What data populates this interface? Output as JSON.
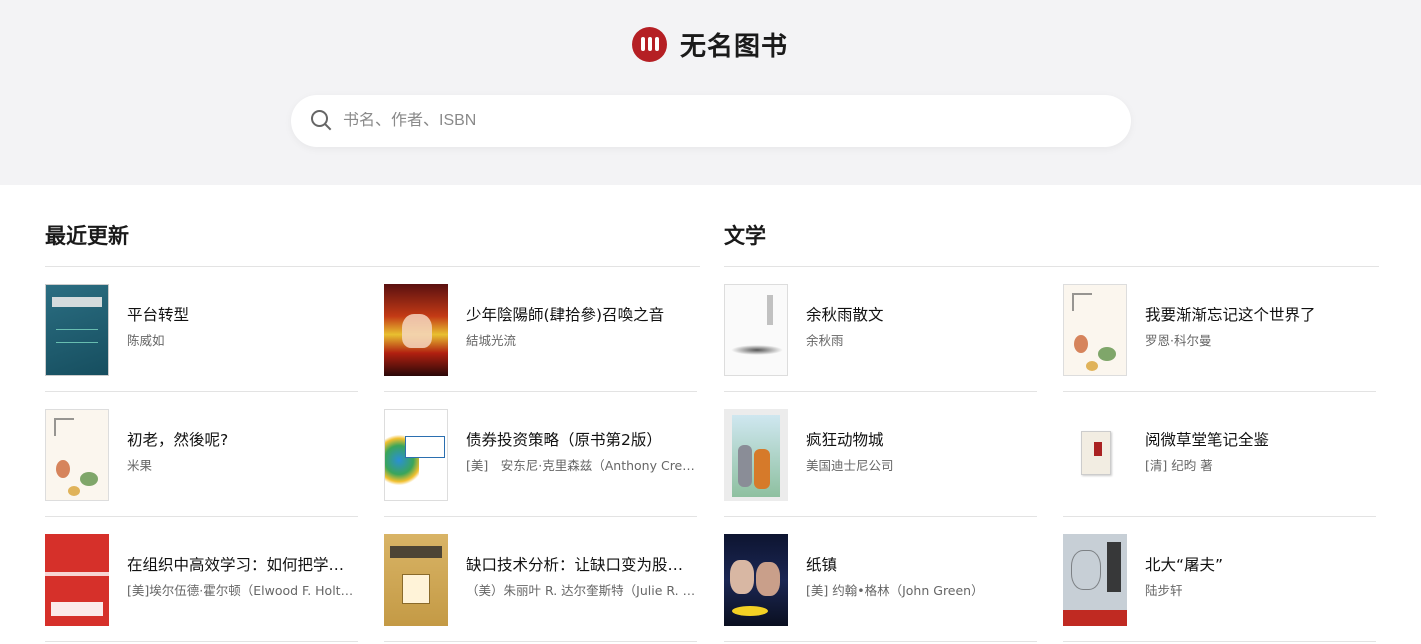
{
  "brand": {
    "name": "无名图书",
    "accent": "#b51f24"
  },
  "search": {
    "placeholder": "书名、作者、ISBN",
    "value": ""
  },
  "sections": [
    {
      "title": "最近更新",
      "books": [
        {
          "title": "平台转型",
          "author": "陈威如"
        },
        {
          "title": "少年陰陽師(肆拾參)召喚之音",
          "author": "結城光流"
        },
        {
          "title": "初老，然後呢?",
          "author": "米果"
        },
        {
          "title": "债券投资策略（原书第2版）",
          "author": "[美]　安东尼·克里森兹（Anthony Crescenzi）"
        },
        {
          "title": "在组织中高效学习：如何把学习转化为生产力",
          "author": "[美]埃尔伍德·霍尔顿（Elwood F. Holton）"
        },
        {
          "title": "缺口技术分析：让缺口变为股市投资的利器",
          "author": "（美）朱丽叶 R. 达尔奎斯特（Julie R. Dahlquist）"
        }
      ]
    },
    {
      "title": "文学",
      "books": [
        {
          "title": "余秋雨散文",
          "author": "余秋雨"
        },
        {
          "title": "我要渐渐忘记这个世界了",
          "author": "罗恩·科尔曼"
        },
        {
          "title": "疯狂动物城",
          "author": "美国迪士尼公司"
        },
        {
          "title": "阅微草堂笔记全鉴",
          "author": "[清] 纪昀 著"
        },
        {
          "title": "纸镇",
          "author": "[美] 约翰•格林（John Green）"
        },
        {
          "title": "北大“屠夫”",
          "author": "陆步轩"
        }
      ]
    }
  ]
}
